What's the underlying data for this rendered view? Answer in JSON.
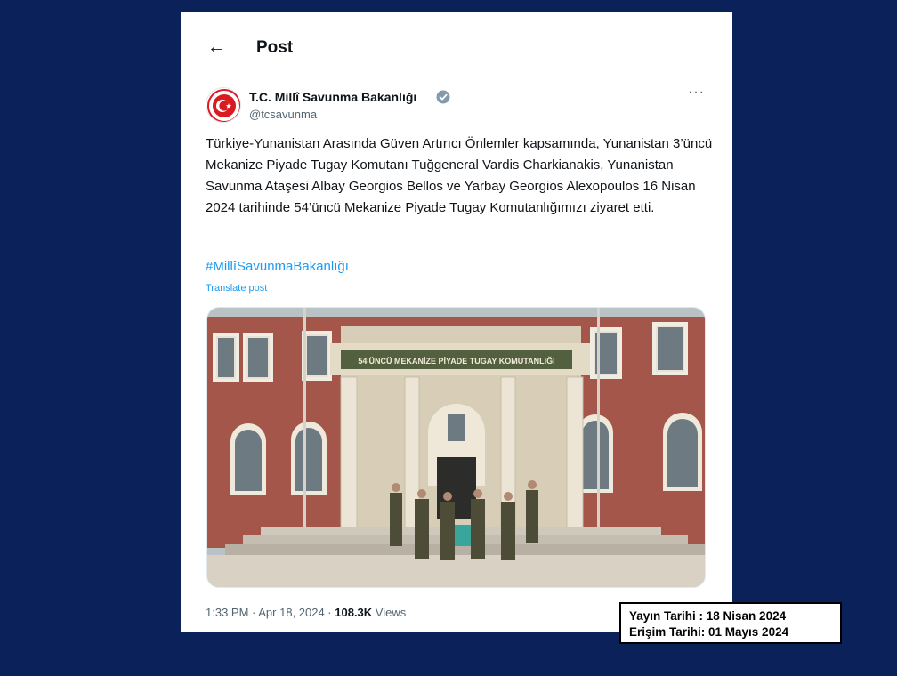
{
  "colors": {
    "background": "#0b2159",
    "link": "#1d9bf0",
    "secondary_text": "#536471"
  },
  "header": {
    "back_icon": "arrow-left-icon",
    "back_glyph": "←",
    "title": "Post"
  },
  "author": {
    "name": "T.C. Millî Savunma Bakanlığı",
    "handle": "@tcsavunma",
    "verified_icon": "verified-badge-icon",
    "avatar_icon": "ministry-emblem-icon"
  },
  "post": {
    "more_glyph": "···",
    "text": "Türkiye-Yunanistan Arasında Güven Artırıcı Önlemler kapsamında, Yunanistan 3’üncü Mekanize Piyade Tugay Komutanı Tuğgeneral Vardis Charkianakis, Yunanistan Savunma Ataşesi Albay Georgios Bellos ve Yarbay Georgios Alexopoulos 16 Nisan 2024 tarihinde 54’üncü Mekanize Piyade Tugay Komutanlığımızı ziyaret etti.",
    "hashtag": "#MillîSavunmaBakanlığı",
    "translate_label": "Translate post",
    "image_sign_text": "54'ÜNCÜ MEKANİZE PİYADE TUGAY KOMUTANLIĞI"
  },
  "meta": {
    "time_date": "1:33 PM · Apr 18, 2024 · ",
    "views_count": "108.3K",
    "views_label": " Views"
  },
  "annotation": {
    "published": "Yayın Tarihi : 18 Nisan 2024",
    "accessed": "Erişim Tarihi: 01 Mayıs 2024"
  }
}
